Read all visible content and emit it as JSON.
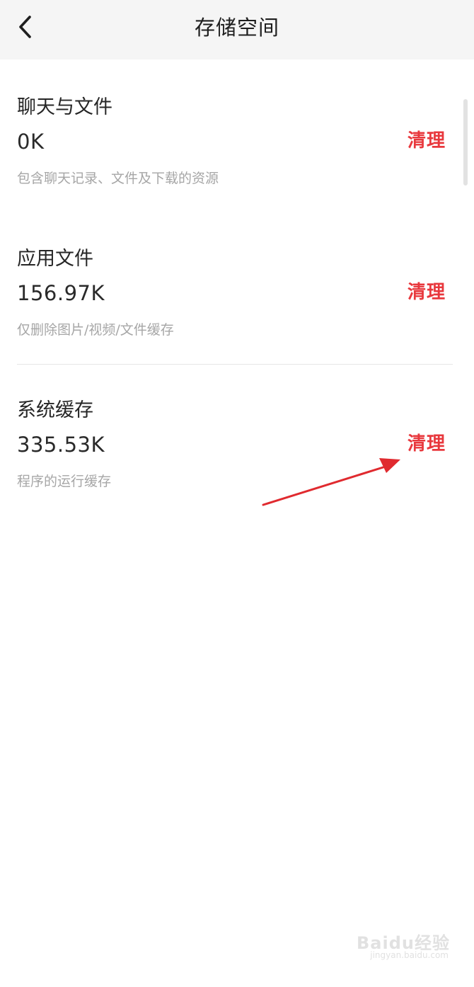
{
  "header": {
    "title": "存储空间",
    "back_icon": "chevron-left-icon"
  },
  "sections": [
    {
      "title": "聊天与文件",
      "size": "0K",
      "description": "包含聊天记录、文件及下载的资源",
      "action_label": "清理"
    },
    {
      "title": "应用文件",
      "size": "156.97K",
      "description": "仅删除图片/视频/文件缓存",
      "action_label": "清理"
    },
    {
      "title": "系统缓存",
      "size": "335.53K",
      "description": "程序的运行缓存",
      "action_label": "清理"
    }
  ],
  "annotation": {
    "icon": "red-arrow-annotation",
    "color": "#e02a2f"
  },
  "watermark": {
    "brand": "Baidu经验",
    "url": "jingyan.baidu.com"
  },
  "colors": {
    "accent": "#e8383d",
    "header_bg": "#f5f5f5",
    "secondary_text": "#a6a6a6"
  }
}
